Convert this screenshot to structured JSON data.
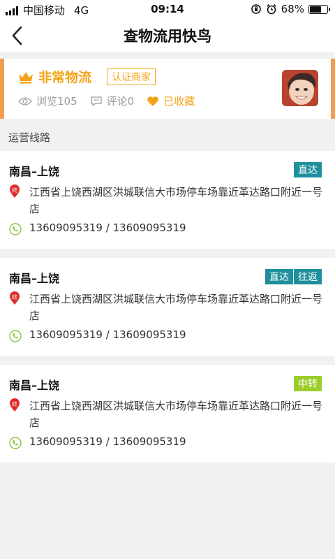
{
  "status_bar": {
    "carrier": "中国移动",
    "network": "4G",
    "time": "09:14",
    "battery": "68%",
    "battery_level": 0.68
  },
  "header": {
    "title": "查物流用快鸟"
  },
  "merchant": {
    "name": "非常物流",
    "cert_badge": "认证商家",
    "views": "浏览105",
    "comments": "评论0",
    "favorite": "已收藏",
    "accent_color": "#f2a416",
    "border_color": "#f29b52"
  },
  "section": {
    "label": "运营线路"
  },
  "routes": [
    {
      "title": "南昌–上饶",
      "tags": [
        "直达"
      ],
      "tag_color": "#1f8f9c",
      "address_icon_label": "终",
      "address": "江西省上饶西湖区洪城联信大市场停车场靠近革达路口附近一号店",
      "phones": "13609095319 / 13609095319"
    },
    {
      "title": "南昌–上饶",
      "tags": [
        "直达",
        "往返"
      ],
      "tag_color": "#1f8f9c",
      "address_icon_label": "终",
      "address": "江西省上饶西湖区洪城联信大市场停车场靠近革达路口附近一号店",
      "phones": "13609095319 / 13609095319"
    },
    {
      "title": "南昌–上饶",
      "tags": [
        "中转"
      ],
      "tag_color": "#9ccc2a",
      "address_icon_label": "终",
      "address": "江西省上饶西湖区洪城联信大市场停车场靠近革达路口附近一号店",
      "phones": "13609095319 / 13609095319"
    }
  ]
}
